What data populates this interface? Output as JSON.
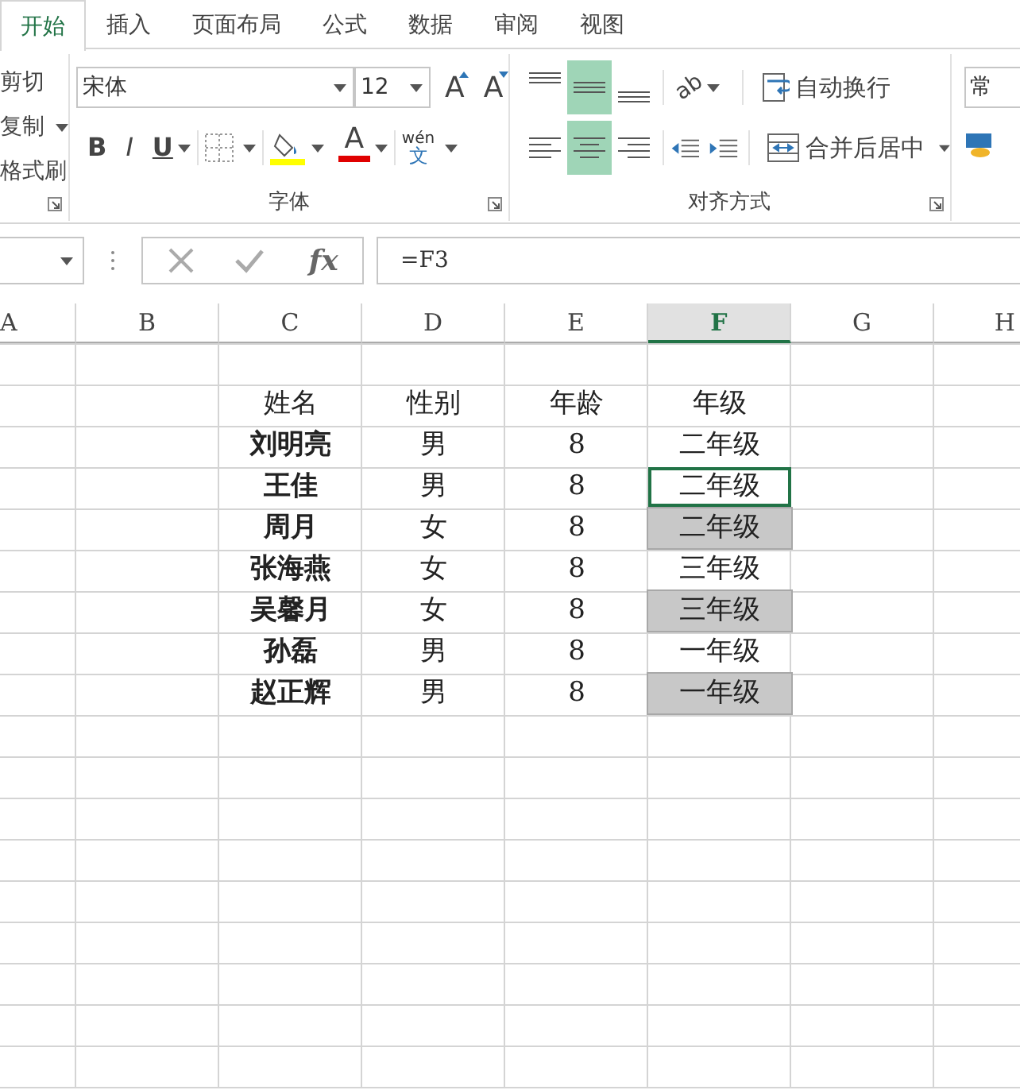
{
  "tabs": [
    {
      "label": "开始",
      "selected": true
    },
    {
      "label": "插入",
      "selected": false
    },
    {
      "label": "页面布局",
      "selected": false
    },
    {
      "label": "公式",
      "selected": false
    },
    {
      "label": "数据",
      "selected": false
    },
    {
      "label": "审阅",
      "selected": false
    },
    {
      "label": "视图",
      "selected": false
    }
  ],
  "clipboard": {
    "items": [
      {
        "label": "剪切",
        "dropdown": false
      },
      {
        "label": "复制",
        "dropdown": true
      },
      {
        "label": "格式刷",
        "dropdown": false
      }
    ]
  },
  "font_group": {
    "font": "宋体",
    "size": "12",
    "grow": "A",
    "shrink": "A",
    "bold": "B",
    "italic": "I",
    "underline": "U",
    "font_color": "A",
    "phonetic_top": "wén",
    "phonetic_bottom": "文",
    "label": "字体"
  },
  "alignment": {
    "vertical": [
      {
        "kind": "top",
        "selected": false
      },
      {
        "kind": "middle",
        "selected": true
      },
      {
        "kind": "bottom",
        "selected": false
      }
    ],
    "horizontal": [
      {
        "kind": "left",
        "selected": false
      },
      {
        "kind": "center",
        "selected": true
      },
      {
        "kind": "right",
        "selected": false
      }
    ],
    "orientation": "ab",
    "wrap_text": "自动换行",
    "merge_center": "合并后居中",
    "label": "对齐方式"
  },
  "number_group": {
    "format": "常"
  },
  "formula_bar": {
    "fx": "fx",
    "formula": "=F3"
  },
  "columns": [
    {
      "label": "A",
      "selected": false
    },
    {
      "label": "B",
      "selected": false
    },
    {
      "label": "C",
      "selected": false
    },
    {
      "label": "D",
      "selected": false
    },
    {
      "label": "E",
      "selected": false
    },
    {
      "label": "F",
      "selected": true
    },
    {
      "label": "G",
      "selected": false
    },
    {
      "label": "H",
      "selected": false
    }
  ],
  "table": {
    "header": [
      "姓名",
      "性别",
      "年龄",
      "年级"
    ],
    "rows": [
      {
        "name": "刘明亮",
        "gender": "男",
        "age": "8",
        "grade": "二年级",
        "shaded": false,
        "active": false
      },
      {
        "name": "王佳",
        "gender": "男",
        "age": "8",
        "grade": "二年级",
        "shaded": false,
        "active": true
      },
      {
        "name": "周月",
        "gender": "女",
        "age": "8",
        "grade": "二年级",
        "shaded": true,
        "active": false
      },
      {
        "name": "张海燕",
        "gender": "女",
        "age": "8",
        "grade": "三年级",
        "shaded": false,
        "active": false
      },
      {
        "name": "吴馨月",
        "gender": "女",
        "age": "8",
        "grade": "三年级",
        "shaded": true,
        "active": false
      },
      {
        "name": "孙磊",
        "gender": "男",
        "age": "8",
        "grade": "一年级",
        "shaded": false,
        "active": false
      },
      {
        "name": "赵正辉",
        "gender": "男",
        "age": "8",
        "grade": "一年级",
        "shaded": true,
        "active": false
      }
    ]
  }
}
